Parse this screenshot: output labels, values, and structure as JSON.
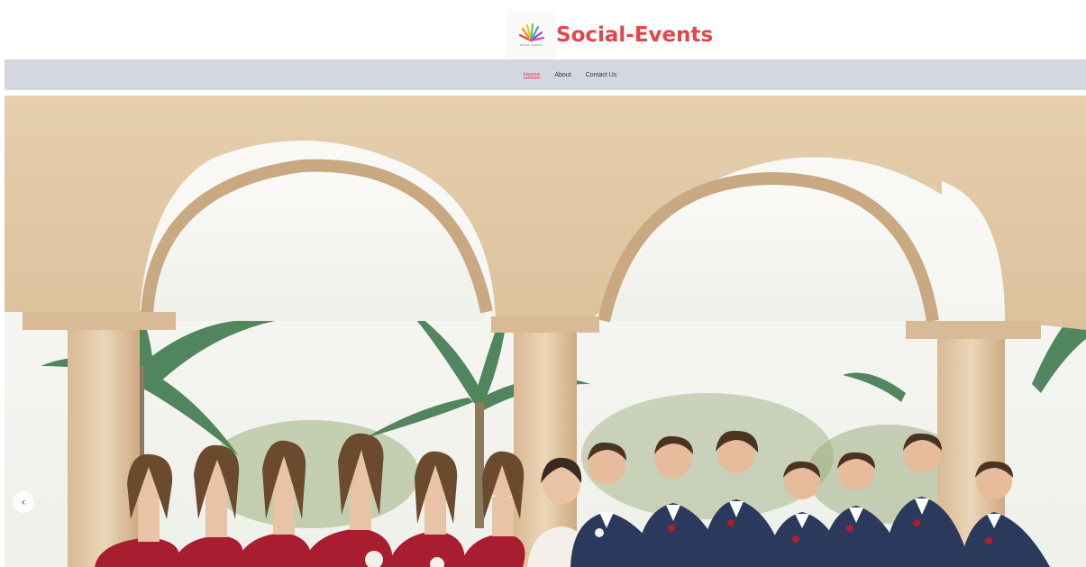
{
  "brand": {
    "name": "Social-Events",
    "logo_caption": "SOCIAL EVENTS",
    "color": "#e0474b"
  },
  "nav": {
    "items": [
      {
        "label": "Home",
        "active": true
      },
      {
        "label": "About",
        "active": false
      },
      {
        "label": "Contact Us",
        "active": false
      }
    ]
  },
  "hero": {
    "image": "wedding-party-photo",
    "prev_label": "‹"
  },
  "colors": {
    "navbar_bg": "#d4d7df",
    "accent": "#e0474b"
  }
}
